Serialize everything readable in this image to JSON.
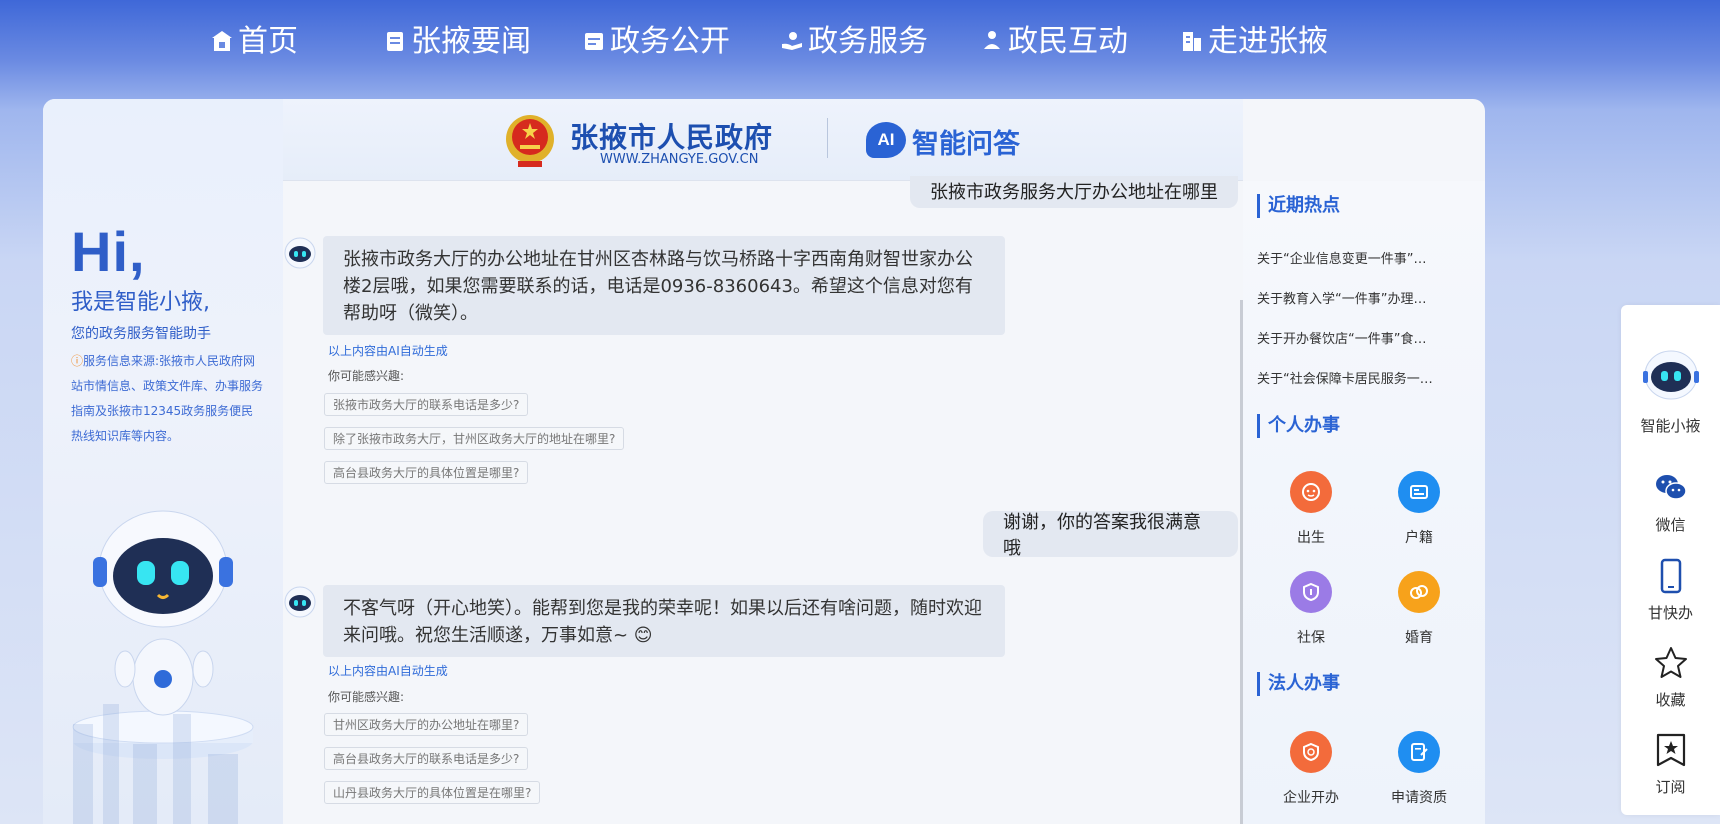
{
  "nav": {
    "items": [
      {
        "label": "首页",
        "icon": "home-icon"
      },
      {
        "label": "张掖要闻",
        "icon": "news-icon"
      },
      {
        "label": "政务公开",
        "icon": "document-icon"
      },
      {
        "label": "政务服务",
        "icon": "service-hand-icon"
      },
      {
        "label": "政民互动",
        "icon": "interaction-icon"
      },
      {
        "label": "走进张掖",
        "icon": "building-icon"
      }
    ]
  },
  "header": {
    "gov_title": "张掖市人民政府",
    "gov_url": "WWW.ZHANGYE.GOV.CN",
    "ai_badge": "AI",
    "ai_title": "智能问答"
  },
  "intro": {
    "hi": "Hi,",
    "name_line": "我是智能小掖,",
    "role_line": "您的政务服务智能助手",
    "source_warn": "ⓘ",
    "source_text": "服务信息来源:张掖市人民政府网站市情信息、政策文件库、办事服务指南及张掖市12345政务服务便民热线知识库等内容。"
  },
  "chat": {
    "user_msg_1": "张掖市政务服务大厅办公地址在哪里",
    "ai_msg_1": "张掖市政务大厅的办公地址在甘州区杏林路与饮马桥路十字西南角财智世家办公楼2层哦，如果您需要联系的话，电话是0936-8360643。希望这个信息对您有帮助呀（微笑）。",
    "ai_generated": "以上内容由AI自动生成",
    "maybe_interest": "你可能感兴趣:",
    "suggestions_1": [
      "张掖市政务大厅的联系电话是多少?",
      "除了张掖市政务大厅，甘州区政务大厅的地址在哪里?",
      "高台县政务大厅的具体位置是哪里?"
    ],
    "user_msg_2": "谢谢，你的答案我很满意哦",
    "ai_msg_2": "不客气呀（开心地笑）。能帮到您是我的荣幸呢！如果以后还有啥问题，随时欢迎来问哦。祝您生活顺遂，万事如意~ 😊",
    "suggestions_2": [
      "甘州区政务大厅的办公地址在哪里?",
      "高台县政务大厅的联系电话是多少?",
      "山丹县政务大厅的具体位置是在哪里?"
    ]
  },
  "right": {
    "hot_title": "近期热点",
    "hot_items": [
      "关于“企业信息变更一件事”…",
      "关于教育入学“一件事”办理…",
      "关于开办餐饮店“一件事”食…",
      "关于“社会保障卡居民服务一…"
    ],
    "personal_title": "个人办事",
    "personal_services": [
      {
        "label": "出生",
        "color": "#f36b3b",
        "icon": "baby-icon"
      },
      {
        "label": "户籍",
        "color": "#1f8ef1",
        "icon": "id-card-icon"
      },
      {
        "label": "社保",
        "color": "#9b7be6",
        "icon": "shield-icon"
      },
      {
        "label": "婚育",
        "color": "#f7a21b",
        "icon": "rings-icon"
      }
    ],
    "legal_title": "法人办事",
    "legal_services": [
      {
        "label": "企业开办",
        "color": "#f36b3b",
        "icon": "enterprise-shield-icon"
      },
      {
        "label": "申请资质",
        "color": "#1f8ef1",
        "icon": "edit-doc-icon"
      }
    ]
  },
  "sidebar": {
    "items": [
      {
        "label": "智能小掖",
        "icon": "robot-icon"
      },
      {
        "label": "微信",
        "icon": "wechat-icon"
      },
      {
        "label": "甘快办",
        "icon": "mobile-icon"
      },
      {
        "label": "收藏",
        "icon": "star-icon"
      },
      {
        "label": "订阅",
        "icon": "subscribe-icon"
      }
    ]
  }
}
